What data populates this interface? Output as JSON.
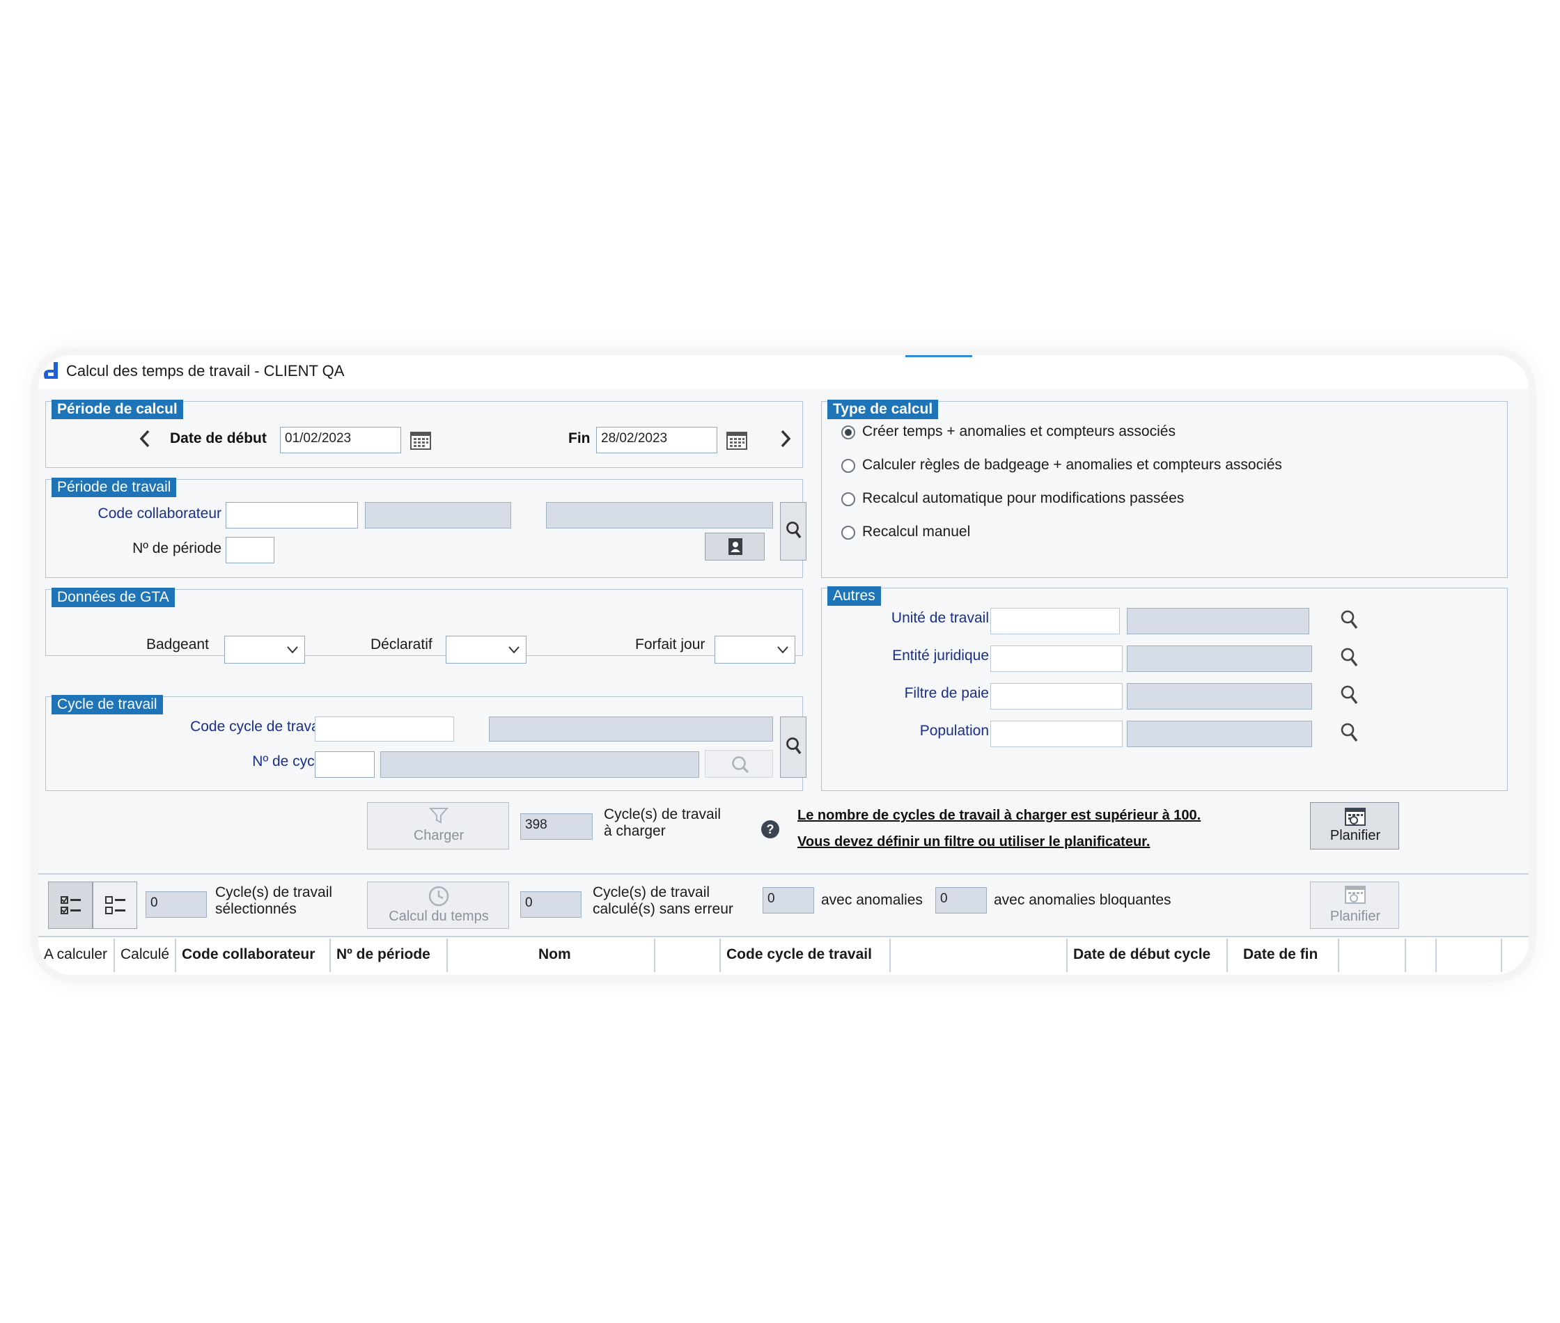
{
  "window": {
    "title": "Calcul des temps de travail - CLIENT QA"
  },
  "periode_calcul": {
    "title": "Période de calcul",
    "date_debut_label": "Date de début",
    "date_debut_value": "01/02/2023",
    "fin_label": "Fin",
    "fin_value": "28/02/2023"
  },
  "periode_travail": {
    "title": "Période de travail",
    "code_collaborateur_label": "Code collaborateur",
    "no_periode_label": "Nº de période"
  },
  "donnees_gta": {
    "title": "Données de GTA",
    "badgeant_label": "Badgeant",
    "declaratif_label": "Déclaratif",
    "forfait_jour_label": "Forfait jour"
  },
  "cycle_travail": {
    "title": "Cycle de travail",
    "code_cycle_label": "Code cycle de travail",
    "no_cycle_label": "Nº de cycle"
  },
  "type_calcul": {
    "title": "Type de calcul",
    "options": [
      "Créer temps + anomalies et compteurs associés",
      "Calculer règles de badgeage + anomalies et compteurs associés",
      "Recalcul automatique pour modifications passées",
      "Recalcul manuel"
    ],
    "selected_index": 0
  },
  "autres": {
    "title": "Autres",
    "unite_travail_label": "Unité de travail",
    "entite_juridique_label": "Entité juridique",
    "filtre_paie_label": "Filtre de paie",
    "population_label": "Population"
  },
  "load": {
    "charger_label": "Charger",
    "count": "398",
    "count_label_1": "Cycle(s) de travail",
    "count_label_2": "à charger",
    "warning_1": "Le nombre de cycles de travail à charger est supérieur à 100.",
    "warning_2": "Vous devez définir un filtre ou utiliser le planificateur.",
    "planifier_label": "Planifier"
  },
  "toolbar": {
    "selected_count": "0",
    "selected_label_1": "Cycle(s) de travail",
    "selected_label_2": "sélectionnés",
    "calcul_label": "Calcul du temps",
    "calc_ok_count": "0",
    "calc_ok_label_1": "Cycle(s) de travail",
    "calc_ok_label_2": "calculé(s) sans erreur",
    "anomalies_count": "0",
    "anomalies_label": "avec anomalies",
    "bloquantes_count": "0",
    "bloquantes_label": "avec anomalies bloquantes",
    "planifier_label": "Planifier"
  },
  "table": {
    "columns": [
      "A calculer",
      "Calculé",
      "Code collaborateur",
      "Nº de période",
      "Nom",
      "Code cycle de travail",
      "Date de début cycle",
      "Date de fin"
    ]
  },
  "colors": {
    "accent": "#1e74b6",
    "label_blue": "#1a2f8c",
    "readonly": "#d6dde6"
  },
  "icons": [
    "app-logo-icon",
    "chevron-left-icon",
    "chevron-right-icon",
    "calendar-icon",
    "search-icon",
    "contact-card-icon",
    "chevron-down-icon",
    "filter-icon",
    "help-icon",
    "planner-icon",
    "clock-icon",
    "check-list-icon",
    "uncheck-list-icon"
  ]
}
